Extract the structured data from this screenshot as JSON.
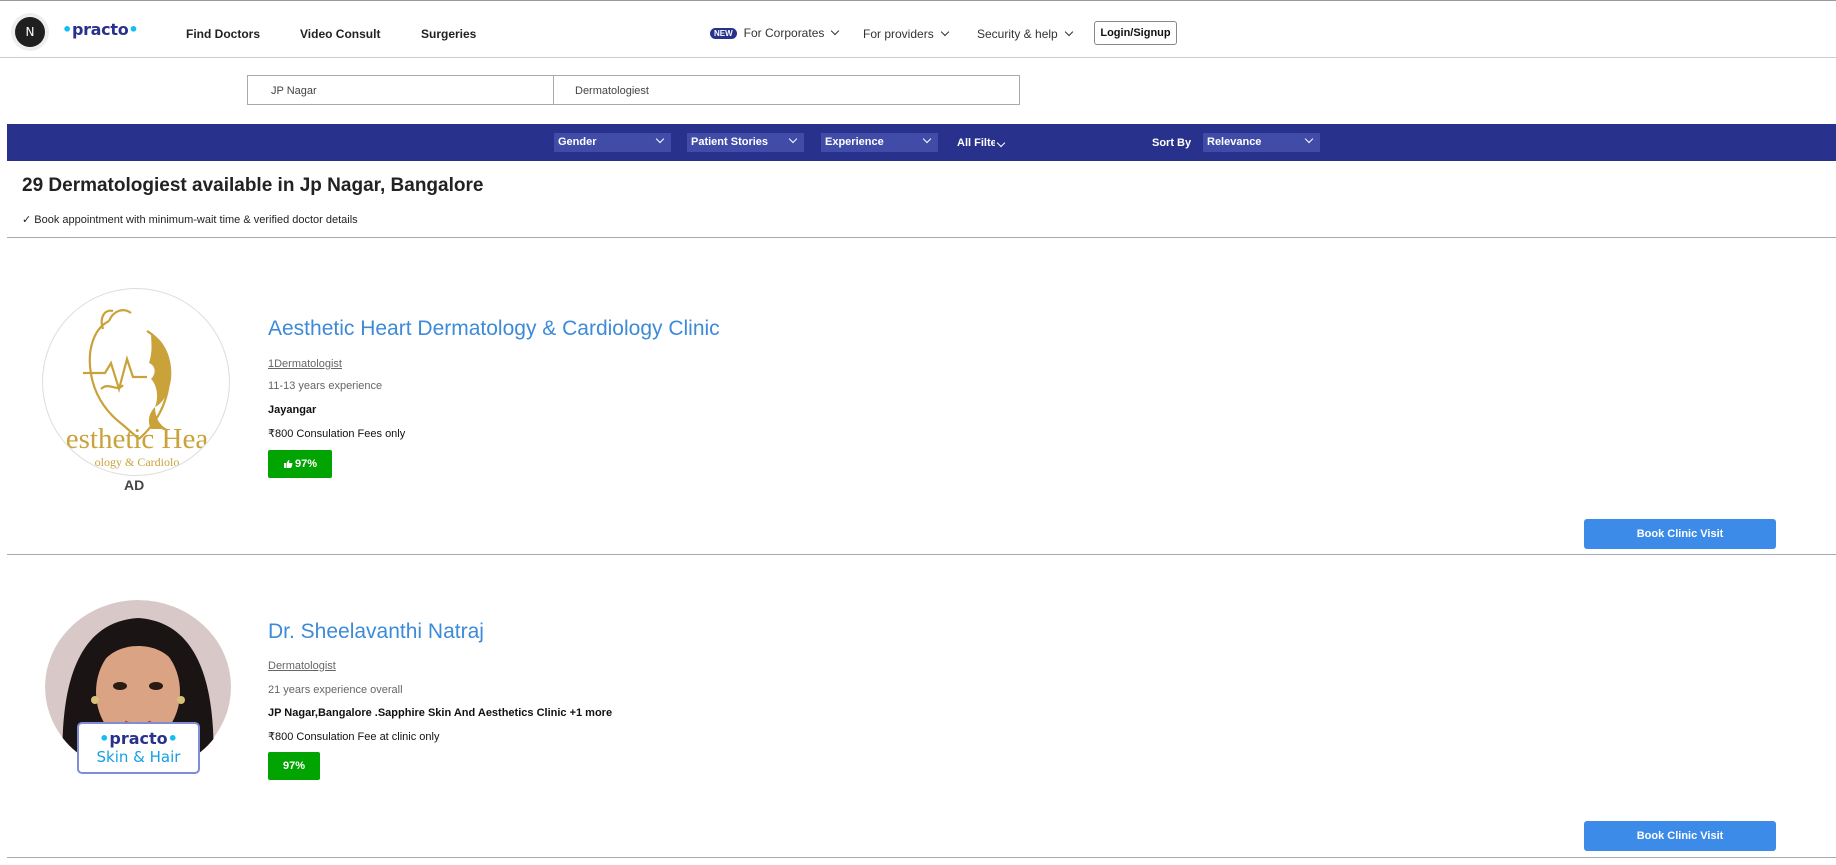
{
  "header": {
    "avatar_letter": "N",
    "logo": {
      "prefix": "•",
      "name": "practo",
      "suffix": "•"
    },
    "nav": [
      "Find Doctors",
      "Video Consult",
      "Surgeries"
    ],
    "new_badge": "NEW",
    "corporates": "For Corporates",
    "providers": "For providers",
    "security": "Security & help",
    "login": "Login/Signup"
  },
  "search": {
    "location": "JP Nagar",
    "specialty": "Dermatologiest"
  },
  "filters": {
    "gender": "Gender",
    "patient_stories": "Patient Stories",
    "experience": "Experience",
    "all_filters": "All Filters",
    "sort_by_label": "Sort By",
    "sort_by_value": "Relevance"
  },
  "results": {
    "title": "29 Dermatologiest available in Jp Nagar, Bangalore",
    "verify": "✓ Book appointment with minimum-wait time & verified doctor details"
  },
  "cards": [
    {
      "name": "Aesthetic Heart Dermatology & Cardiology Clinic",
      "specialty": "1Dermatologist",
      "experience": "11-13 years experience",
      "location": "Jayangar",
      "fee": "₹800 Consulation Fees only",
      "rating": "97%",
      "ad": "AD",
      "logo_text": "esthetic Hea",
      "logo_sub": "ology & Cardiolo",
      "book": "Book Clinic Visit"
    },
    {
      "name": "Dr. Sheelavanthi Natraj",
      "specialty": "Dermatologist",
      "experience": "21 years experience overall",
      "location": "JP Nagar,Bangalore .Sapphire Skin And Aesthetics Clinic +1 more",
      "fee": "₹800 Consulation Fee at clinic only",
      "rating": "97%",
      "badge_line1": "practo",
      "badge_line2": "Skin & Hair",
      "book": "Book Clinic Visit"
    }
  ],
  "colors": {
    "brand": "#28328c",
    "accent": "#14bef0",
    "link": "#3d8bd8",
    "rating": "#01a400",
    "button": "#3d8be8"
  }
}
